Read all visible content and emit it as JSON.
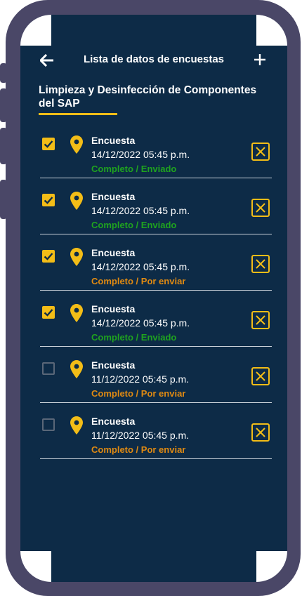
{
  "header": {
    "title": "Lista de datos de encuestas"
  },
  "section": {
    "title": "Limpieza y Desinfección de Componentes del SAP"
  },
  "colors": {
    "background": "#0d2b47",
    "accent": "#f3bd17",
    "sent": "#1fa31f",
    "pending": "#e08a12"
  },
  "icons": {
    "back": "arrow-left-icon",
    "add": "plus-icon",
    "location": "map-pin-icon",
    "delete": "close-box-icon"
  },
  "surveys": [
    {
      "name": "Encuesta",
      "date": "14/12/2022 05:45 p.m.",
      "status": "Completo / Enviado",
      "checked": true,
      "state": "sent"
    },
    {
      "name": "Encuesta",
      "date": "14/12/2022 05:45 p.m.",
      "status": "Completo / Enviado",
      "checked": true,
      "state": "sent"
    },
    {
      "name": "Encuesta",
      "date": "14/12/2022 05:45 p.m.",
      "status": "Completo / Por enviar",
      "checked": true,
      "state": "pending"
    },
    {
      "name": "Encuesta",
      "date": "14/12/2022 05:45 p.m.",
      "status": "Completo / Enviado",
      "checked": true,
      "state": "sent"
    },
    {
      "name": "Encuesta",
      "date": "11/12/2022 05:45 p.m.",
      "status": "Completo / Por enviar",
      "checked": false,
      "state": "pending"
    },
    {
      "name": "Encuesta",
      "date": "11/12/2022 05:45 p.m.",
      "status": "Completo / Por enviar",
      "checked": false,
      "state": "pending"
    }
  ]
}
